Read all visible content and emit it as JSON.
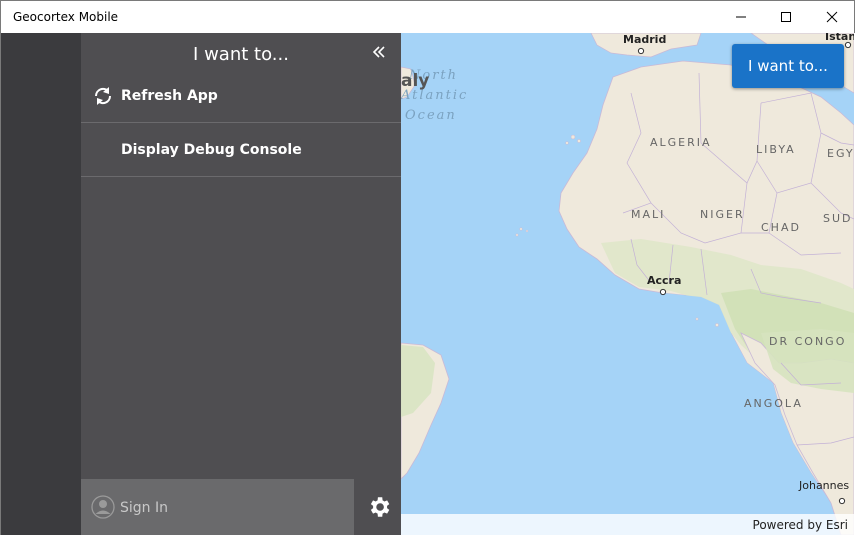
{
  "window": {
    "title": "Geocortex Mobile"
  },
  "panel": {
    "title": "I want to...",
    "items": [
      {
        "label": "Refresh App",
        "icon": "refresh-icon"
      },
      {
        "label": "Display Debug Console",
        "icon": ""
      }
    ],
    "signin_label": "Sign In"
  },
  "map": {
    "button_label": "I want to...",
    "attribution": "Powered by Esri",
    "places": {
      "madrid": "Madrid",
      "istanbul": "Istan",
      "algeria": "ALGERIA",
      "libya": "LIBYA",
      "egypt": "EGY",
      "mali": "MALI",
      "niger": "NIGER",
      "chad": "CHAD",
      "sudan": "SUD",
      "accra": "Accra",
      "drcongo": "DR CONGO",
      "angola": "ANGOLA",
      "johannesburg": "Johannes",
      "ocean_line1": "North",
      "ocean_line2": "Atlantic",
      "ocean_line3": "Ocean",
      "partial": "aly"
    }
  },
  "colors": {
    "accent": "#1a73c8",
    "panel_bg": "#4f4e51",
    "strip_bg": "#3b3b3e",
    "water": "#a5d3f7",
    "land": "#efe9dc"
  }
}
